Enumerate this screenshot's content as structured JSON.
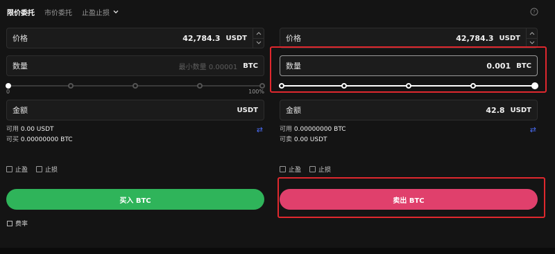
{
  "tabs": [
    {
      "label": "限价委托"
    },
    {
      "label": "市价委托"
    },
    {
      "label": "止盈止损"
    }
  ],
  "left": {
    "price": {
      "label": "价格",
      "value": "42,784.3",
      "unit": "USDT"
    },
    "amount": {
      "label": "数量",
      "placeholder": "最小数量 0.00001",
      "unit": "BTC"
    },
    "slider": {
      "min_label": "0",
      "max_label": "100%",
      "level": 0
    },
    "total": {
      "label": "金额",
      "unit": "USDT"
    },
    "available": {
      "label": "可用",
      "value": "0.00 USDT"
    },
    "can_trade": {
      "label": "可买",
      "value": "0.00000000 BTC"
    },
    "take_profit": "止盈",
    "stop_loss": "止损",
    "action": "买入 BTC"
  },
  "right": {
    "price": {
      "label": "价格",
      "value": "42,784.3",
      "unit": "USDT"
    },
    "amount": {
      "label": "数量",
      "value": "0.001",
      "unit": "BTC"
    },
    "slider": {
      "level": 1.0
    },
    "total": {
      "label": "金额",
      "value": "42.8",
      "unit": "USDT"
    },
    "available": {
      "label": "可用",
      "value": "0.00000000 BTC"
    },
    "can_trade": {
      "label": "可卖",
      "value": "0.00 USDT"
    },
    "take_profit": "止盈",
    "stop_loss": "止损",
    "action": "卖出 BTC"
  },
  "rate_label": "费率",
  "colors": {
    "buy": "#2fb45a",
    "sell": "#e0406c",
    "highlight": "#e0282e",
    "swap": "#4a6cf7"
  }
}
